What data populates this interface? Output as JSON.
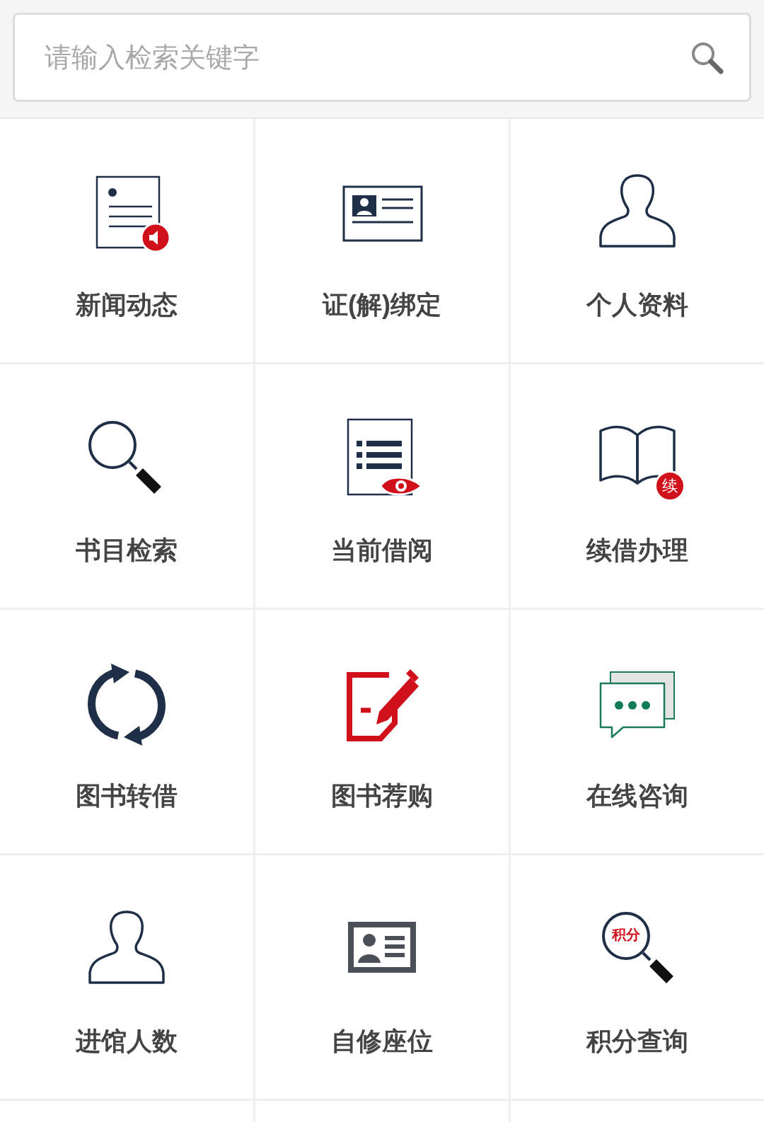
{
  "search": {
    "placeholder": "请输入检索关键字"
  },
  "items": [
    {
      "label": "新闻动态",
      "kind": "news"
    },
    {
      "label": "证(解)绑定",
      "kind": "card"
    },
    {
      "label": "个人资料",
      "kind": "person"
    },
    {
      "label": "书目检索",
      "kind": "search"
    },
    {
      "label": "当前借阅",
      "kind": "borrow"
    },
    {
      "label": "续借办理",
      "kind": "book",
      "badge": "续"
    },
    {
      "label": "图书转借",
      "kind": "cycle"
    },
    {
      "label": "图书荐购",
      "kind": "pen"
    },
    {
      "label": "在线咨询",
      "kind": "chat"
    },
    {
      "label": "进馆人数",
      "kind": "person"
    },
    {
      "label": "自修座位",
      "kind": "seat"
    },
    {
      "label": "积分查询",
      "kind": "points",
      "badge": "积分"
    }
  ]
}
